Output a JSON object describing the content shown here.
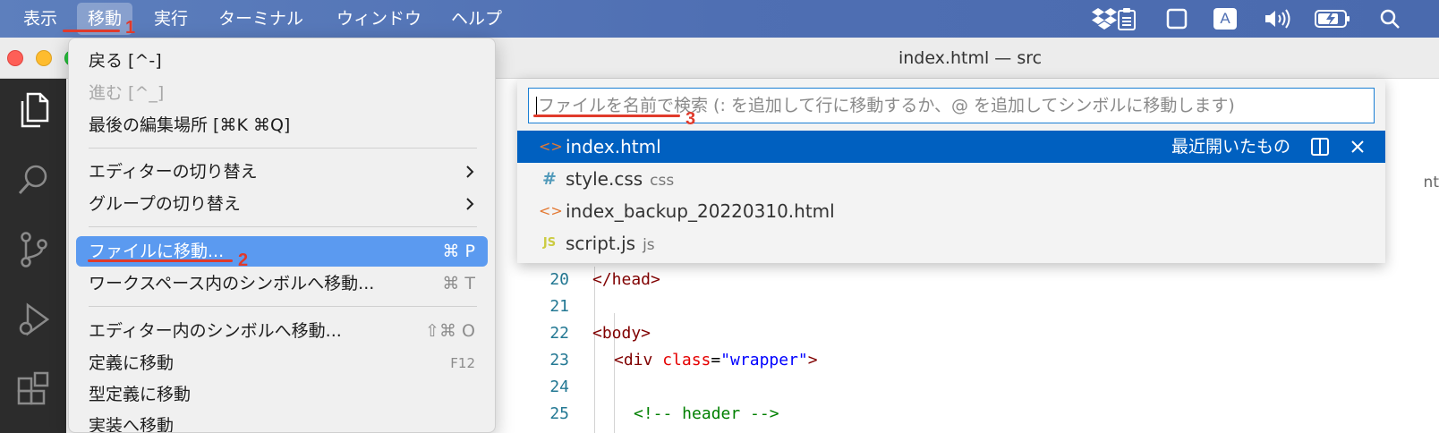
{
  "menubar": {
    "items": [
      "表示",
      "移動",
      "実行",
      "ターミナル",
      "ウィンドウ",
      "ヘルプ"
    ],
    "tray_icons": [
      "dropbox-icon",
      "clipboard-icon",
      "window-icon",
      "input-method-icon",
      "volume-icon",
      "battery-icon",
      "spotlight-search-icon"
    ],
    "input_method_label": "A"
  },
  "window": {
    "title": "index.html — src"
  },
  "go_menu": {
    "items": [
      {
        "label": "戻る [^-]",
        "shortcut": "",
        "disabled": false
      },
      {
        "label": "進む [^_]",
        "shortcut": "",
        "disabled": true
      },
      {
        "label": "最後の編集場所 [⌘K ⌘Q]",
        "shortcut": "",
        "disabled": false
      },
      {
        "label": "エディターの切り替え",
        "submenu": true
      },
      {
        "label": "グループの切り替え",
        "submenu": true
      },
      {
        "label": "ファイルに移動...",
        "shortcut": "⌘ P",
        "selected": true
      },
      {
        "label": "ワークスペース内のシンボルへ移動...",
        "shortcut": "⌘ T"
      },
      {
        "label": "エディター内のシンボルへ移動...",
        "shortcut": "⇧⌘ O"
      },
      {
        "label": "定義に移動",
        "shortcut": "F12"
      },
      {
        "label": "型定義に移動",
        "shortcut": ""
      },
      {
        "label": "実装へ移動",
        "shortcut": ""
      }
    ]
  },
  "quick_open": {
    "placeholder": "ファイルを名前で検索 (: を追加して行に移動するか、@ を追加してシンボルに移動します)",
    "recent_label": "最近開いたもの",
    "results": [
      {
        "icon": "<>",
        "name": "index.html",
        "desc": "",
        "icon_color": "#e37933"
      },
      {
        "icon": "#",
        "name": "style.css",
        "desc": "css",
        "icon_color": "#519aba"
      },
      {
        "icon": "<>",
        "name": "index_backup_20220310.html",
        "desc": "",
        "icon_color": "#e37933"
      },
      {
        "icon": "JS",
        "name": "script.js",
        "desc": "js",
        "icon_color": "#cbcb41"
      }
    ]
  },
  "editor": {
    "lines": [
      {
        "num": "20",
        "text": "</head>"
      },
      {
        "num": "21",
        "text": ""
      },
      {
        "num": "22",
        "text": "<body>"
      },
      {
        "num": "23",
        "text": "<div class=\"wrapper\">"
      },
      {
        "num": "24",
        "text": ""
      },
      {
        "num": "25",
        "text": "<!-- header -->"
      }
    ],
    "tab_fragment": "nt"
  },
  "annotations": [
    "1",
    "2",
    "3"
  ],
  "colors": {
    "menu_selected": "#5b9af0",
    "quickopen_selected": "#0060c0",
    "annotation_red": "#e03a2b"
  }
}
